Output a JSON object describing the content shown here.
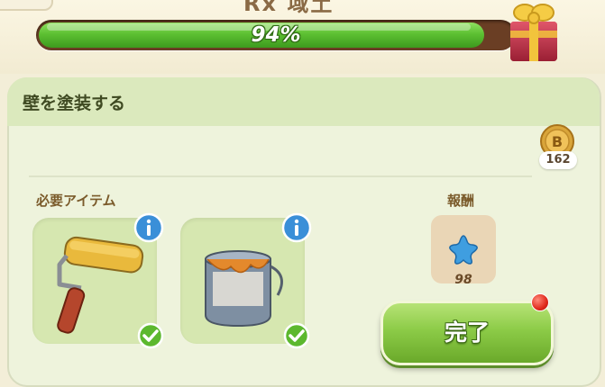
{
  "header": {
    "title_fragment": "Rx 域土",
    "progress": {
      "value_percent": 94,
      "label": "94%"
    },
    "reward_chest_icon": "gift-box-icon"
  },
  "task": {
    "title": "壁を塗装する",
    "currency": {
      "icon": "coin-b-icon",
      "count": "162"
    },
    "required_items_label": "必要アイテム",
    "required_items": [
      {
        "name": "paint-roller",
        "icon": "paint-roller-icon",
        "has_info": true,
        "fulfilled": true
      },
      {
        "name": "paint-can",
        "icon": "paint-can-icon",
        "has_info": true,
        "fulfilled": true
      }
    ],
    "reward_label": "報酬",
    "reward": {
      "icon": "blue-star-icon",
      "count": "98"
    },
    "complete_button": {
      "label": "完了",
      "has_notification": true
    }
  },
  "colors": {
    "progress_fill": "#5dc032",
    "progress_track": "#6a3e24",
    "panel_bg": "#eef3dc",
    "button_green": "#8ccb47",
    "info_blue": "#3a8fd8",
    "check_green": "#5cb82e",
    "notify_red": "#e02a1c"
  }
}
